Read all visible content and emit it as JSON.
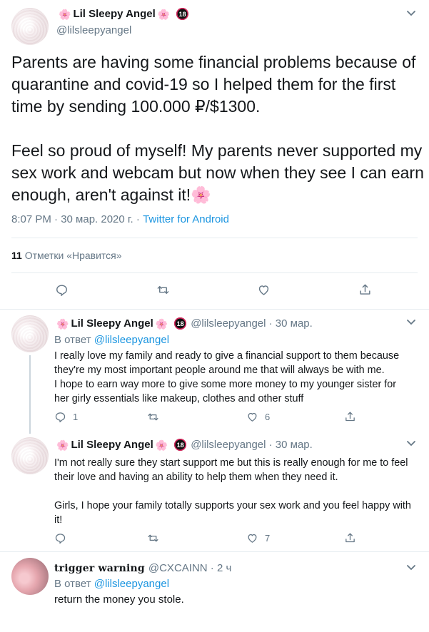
{
  "main_tweet": {
    "author": {
      "display_name": "Lil Sleepy Angel",
      "badge_left": "🌸",
      "badge_right": "🌸",
      "badge_18": "18",
      "handle": "@lilsleepyangel"
    },
    "paragraphs": [
      "Parents are having some financial problems because of quarantine and covid-19 so I helped them for the first time by sending 100.000 ₽/$1300.",
      "Feel so proud of myself! My parents never supported my sex work and webcam but now when they see I can earn enough, aren't against it!🌸"
    ],
    "timestamp": "8:07 PM · 30 мар. 2020 г.",
    "meta_sep": " · ",
    "source": "Twitter for Android",
    "likes_count": "11",
    "likes_label": "Отметки «Нравится»"
  },
  "replies": [
    {
      "display_name": "Lil Sleepy Angel",
      "badge_left": "🌸",
      "badge_right": "🌸",
      "badge_18": "18",
      "handle_time": "@lilsleepyangel · 30 мар.",
      "reply_to_label": "В ответ",
      "reply_to_mention": "@lilsleepyangel",
      "text_lines": [
        "I really love my family and ready to give a financial support to them because",
        "they're my most important people around me that will always be with me.",
        "I hope to earn way more to give some more money to my younger sister for",
        "her girly essentials like makeup, clothes and other stuff"
      ],
      "reply_count": "1",
      "retweet_count": "",
      "like_count": "6"
    },
    {
      "display_name": "Lil Sleepy Angel",
      "badge_left": "🌸",
      "badge_right": "🌸",
      "badge_18": "18",
      "handle_time": "@lilsleepyangel · 30 мар.",
      "text_paragraphs": [
        "I'm not really sure they start support me but this is really enough for me to feel their love and having an ability to help them when they need it.",
        "Girls, I hope your family totally supports your sex work and you feel happy with it!"
      ],
      "reply_count": "",
      "retweet_count": "",
      "like_count": "7"
    },
    {
      "display_name": "𝐭𝐫𝐢𝐠𝐠𝐞𝐫 𝐰𝐚𝐫𝐧𝐢𝐧𝐠",
      "handle_time": "@CXCAINN · 2 ч",
      "reply_to_label": "В ответ",
      "reply_to_mention": "@lilsleepyangel",
      "text": "return the money you stole."
    }
  ],
  "icons": [
    "chevron-down-icon",
    "reply-icon",
    "retweet-icon",
    "like-icon",
    "share-icon"
  ],
  "colors": {
    "link": "#1b95e0",
    "muted": "#657786",
    "border": "#e6ecf0",
    "text": "#14171a"
  }
}
